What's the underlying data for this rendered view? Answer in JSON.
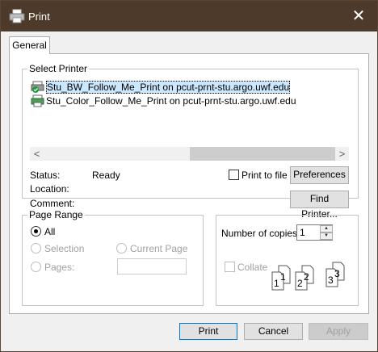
{
  "window": {
    "title": "Print",
    "close_glyph": "✕"
  },
  "tabs": [
    {
      "label": "General"
    }
  ],
  "select_printer": {
    "label": "Select Printer",
    "printers": [
      {
        "name": "Stu_BW_Follow_Me_Print on pcut-prnt-stu.argo.uwf.edu",
        "icon": "printer-default-icon",
        "selected": true
      },
      {
        "name": "Stu_Color_Follow_Me_Print on pcut-prnt-stu.argo.uwf.edu",
        "icon": "printer-icon",
        "selected": false
      }
    ],
    "scroll_left": "<",
    "scroll_right": ">"
  },
  "status": {
    "status_label": "Status:",
    "status_value": "Ready",
    "location_label": "Location:",
    "comment_label": "Comment:",
    "print_to_file_label": "Print to file",
    "preferences_label": "Preferences",
    "find_printer_label": "Find Printer..."
  },
  "page_range": {
    "label": "Page Range",
    "all_label": "All",
    "selection_label": "Selection",
    "current_page_label": "Current Page",
    "pages_label": "Pages:",
    "pages_value": ""
  },
  "copies": {
    "number_label": "Number of copies:",
    "number_value": "1",
    "collate_label": "Collate",
    "collate_pages": [
      "1",
      "1",
      "2",
      "2",
      "3",
      "3"
    ]
  },
  "footer": {
    "print_label": "Print",
    "cancel_label": "Cancel",
    "apply_label": "Apply"
  },
  "colors": {
    "titlebar": "#4d3a2a",
    "selection": "#cce8ff",
    "default_button_border": "#0078d7"
  }
}
